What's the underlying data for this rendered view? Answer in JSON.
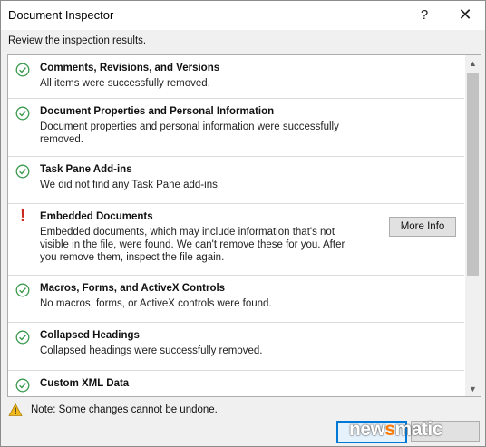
{
  "window": {
    "title": "Document Inspector",
    "help_glyph": "?",
    "close_glyph": "✕"
  },
  "subtitle": "Review the inspection results.",
  "results": [
    {
      "status": "ok",
      "name": "Comments, Revisions, and Versions",
      "desc": "All items were successfully removed."
    },
    {
      "status": "ok",
      "name": "Document Properties and Personal Information",
      "desc": "Document properties and personal information were successfully removed."
    },
    {
      "status": "ok",
      "name": "Task Pane Add-ins",
      "desc": "We did not find any Task Pane add-ins."
    },
    {
      "status": "warning",
      "name": "Embedded Documents",
      "desc": "Embedded documents, which may include information that's not visible in the file, were found. We can't remove these for you. After you remove them, inspect the file again.",
      "button": "More Info"
    },
    {
      "status": "ok",
      "name": "Macros, Forms, and ActiveX Controls",
      "desc": "No macros, forms, or ActiveX controls were found."
    },
    {
      "status": "ok",
      "name": "Collapsed Headings",
      "desc": "Collapsed headings were successfully removed."
    },
    {
      "status": "ok",
      "name": "Custom XML Data",
      "desc": ""
    }
  ],
  "note": "Note: Some changes cannot be undone.",
  "watermark": {
    "prefix": "new",
    "accent": "s",
    "suffix": "matic"
  },
  "colors": {
    "ok": "#3c9a4f",
    "warning": "#cc2a1e",
    "accent": "#0078d7"
  }
}
